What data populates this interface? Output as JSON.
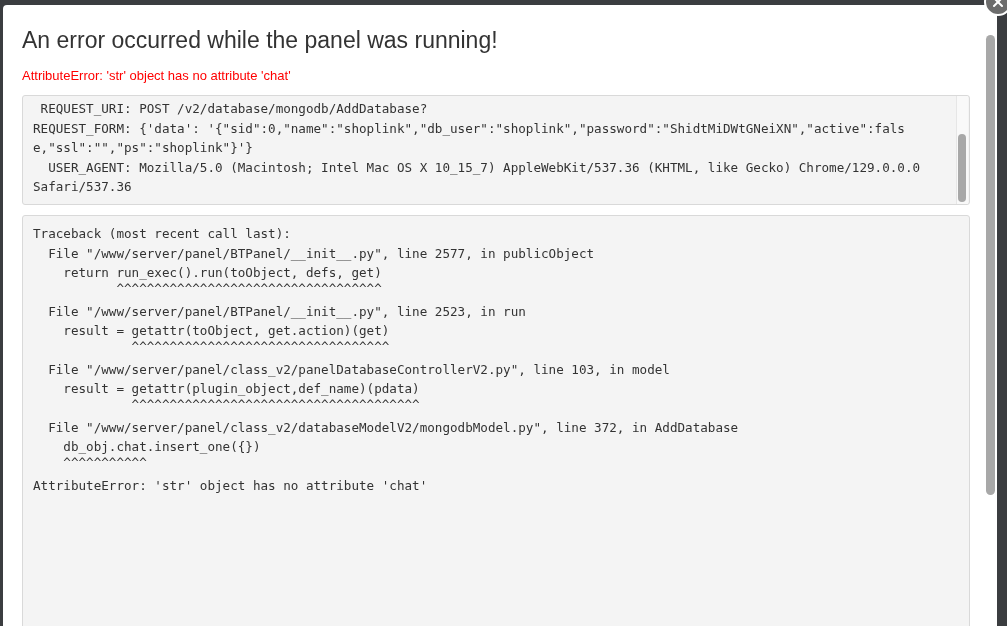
{
  "dialog": {
    "title": "An error occurred while the panel was running!",
    "error_message": "AttributeError: 'str' object has no attribute 'chat'",
    "request_lines": [
      " REQUEST_URI: POST /v2/database/mongodb/AddDatabase?",
      "REQUEST_FORM: {'data': '{\"sid\":0,\"name\":\"shoplink\",\"db_user\":\"shoplink\",\"password\":\"ShidtMiDWtGNeiXN\",\"active\":fals",
      "e,\"ssl\":\"\",\"ps\":\"shoplink\"}'}",
      "  USER_AGENT: Mozilla/5.0 (Macintosh; Intel Mac OS X 10_15_7) AppleWebKit/537.36 (KHTML, like Gecko) Chrome/129.0.0.0",
      "Safari/537.36"
    ],
    "traceback_lines": [
      "Traceback (most recent call last):",
      "  File \"/www/server/panel/BTPanel/__init__.py\", line 2577, in publicObject",
      "    return run_exec().run(toObject, defs, get)",
      "           ^^^^^^^^^^^^^^^^^^^^^^^^^^^^^^^^^^^",
      "  File \"/www/server/panel/BTPanel/__init__.py\", line 2523, in run",
      "    result = getattr(toObject, get.action)(get)",
      "             ^^^^^^^^^^^^^^^^^^^^^^^^^^^^^^^^^^",
      "  File \"/www/server/panel/class_v2/panelDatabaseControllerV2.py\", line 103, in model",
      "    result = getattr(plugin_object,def_name)(pdata)",
      "             ^^^^^^^^^^^^^^^^^^^^^^^^^^^^^^^^^^^^^^",
      "  File \"/www/server/panel/class_v2/databaseModelV2/mongodbModel.py\", line 372, in AddDatabase",
      "    db_obj.chat.insert_one({})",
      "    ^^^^^^^^^^^",
      "AttributeError: 'str' object has no attribute 'chat'"
    ]
  }
}
